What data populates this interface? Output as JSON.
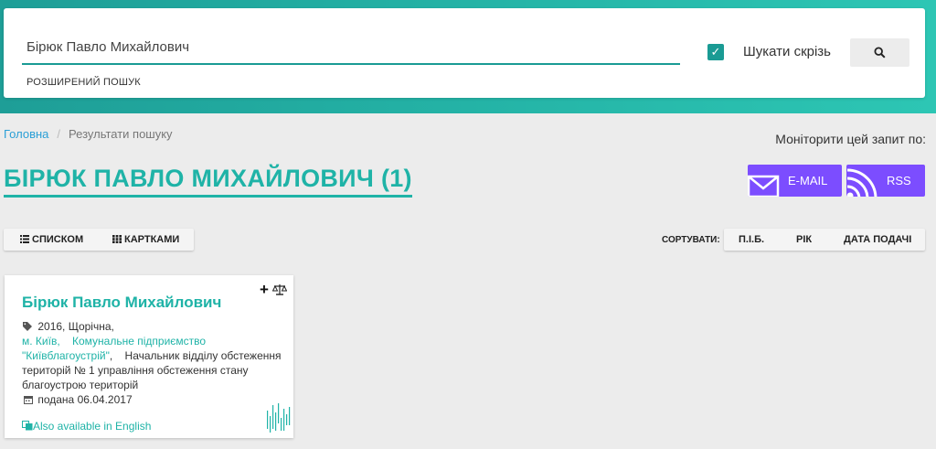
{
  "search": {
    "value": "Бірюк Павло Михайлович",
    "advanced_label": "РОЗШИРЕНИЙ ПОШУК",
    "everywhere_label": "Шукати скрізь",
    "everywhere_checked": true
  },
  "breadcrumb": {
    "home": "Головна",
    "current": "Результати пошуку"
  },
  "monitor": {
    "label": "Моніторити цей запит по:",
    "email_label": "E-MAIL",
    "rss_label": "RSS"
  },
  "title": "БІРЮК ПАВЛО МИХАЙЛОВИЧ (1)",
  "view": {
    "list_label": "СПИСКОМ",
    "cards_label": "КАРТКАМИ"
  },
  "sort": {
    "label": "СОРТУВАТИ:",
    "name_label": "П.І.Б.",
    "year_label": "РІК",
    "date_label": "ДАТА ПОДАЧІ"
  },
  "result": {
    "name": "Бірюк Павло Михайлович",
    "meta": "2016, Щорічна,",
    "city": "м. Київ,",
    "org_part1": "Комунальне підприємство",
    "org_part2": "\"Київблагоустрій\"",
    "position_part1": ",    Начальник відділу обстеження",
    "position_part2": "територій № 1 управління обстеження стану",
    "position_part3": "благоустрою територій",
    "submitted": "подана 06.04.2017",
    "english": "Also available in English"
  },
  "colors": {
    "accent": "#1fb3a7",
    "subscribe": "#7c4dff",
    "link": "#2a9fd6"
  }
}
